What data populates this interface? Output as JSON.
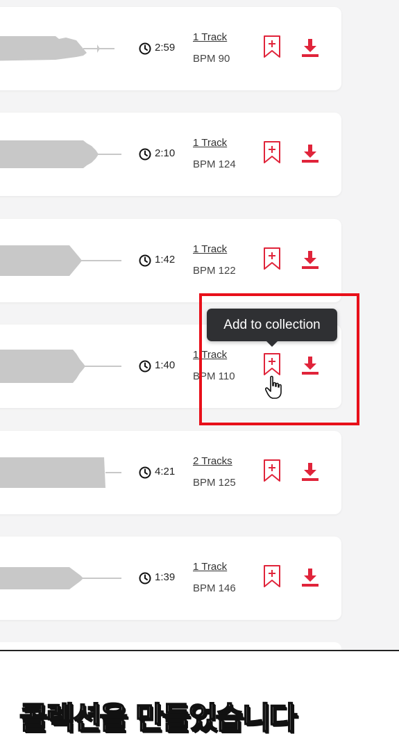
{
  "tracks": [
    {
      "duration": "2:59",
      "tracks": "1 Track",
      "bpm": "BPM 90",
      "wave": "w1"
    },
    {
      "duration": "2:10",
      "tracks": "1 Track",
      "bpm": "BPM 124",
      "wave": "w2"
    },
    {
      "duration": "1:42",
      "tracks": "1 Track",
      "bpm": "BPM 122",
      "wave": "w3"
    },
    {
      "duration": "1:40",
      "tracks": "1 Track",
      "bpm": "BPM 110",
      "wave": "w4"
    },
    {
      "duration": "4:21",
      "tracks": "2 Tracks",
      "bpm": "BPM 125",
      "wave": "w5"
    },
    {
      "duration": "1:39",
      "tracks": "1 Track",
      "bpm": "BPM 146",
      "wave": "w6"
    }
  ],
  "tooltip": {
    "text": "Add to collection"
  },
  "caption": {
    "text": "콜렉션을 만들었습니다"
  },
  "colors": {
    "accent": "#e0243a",
    "waveform": "#c8c8c8",
    "highlight": "#e8101a",
    "tooltip_bg": "#2f3033"
  },
  "icons": {
    "duration": "clock-icon",
    "collection": "bookmark-plus-icon",
    "download": "download-icon",
    "pointer": "hand-cursor-icon"
  }
}
